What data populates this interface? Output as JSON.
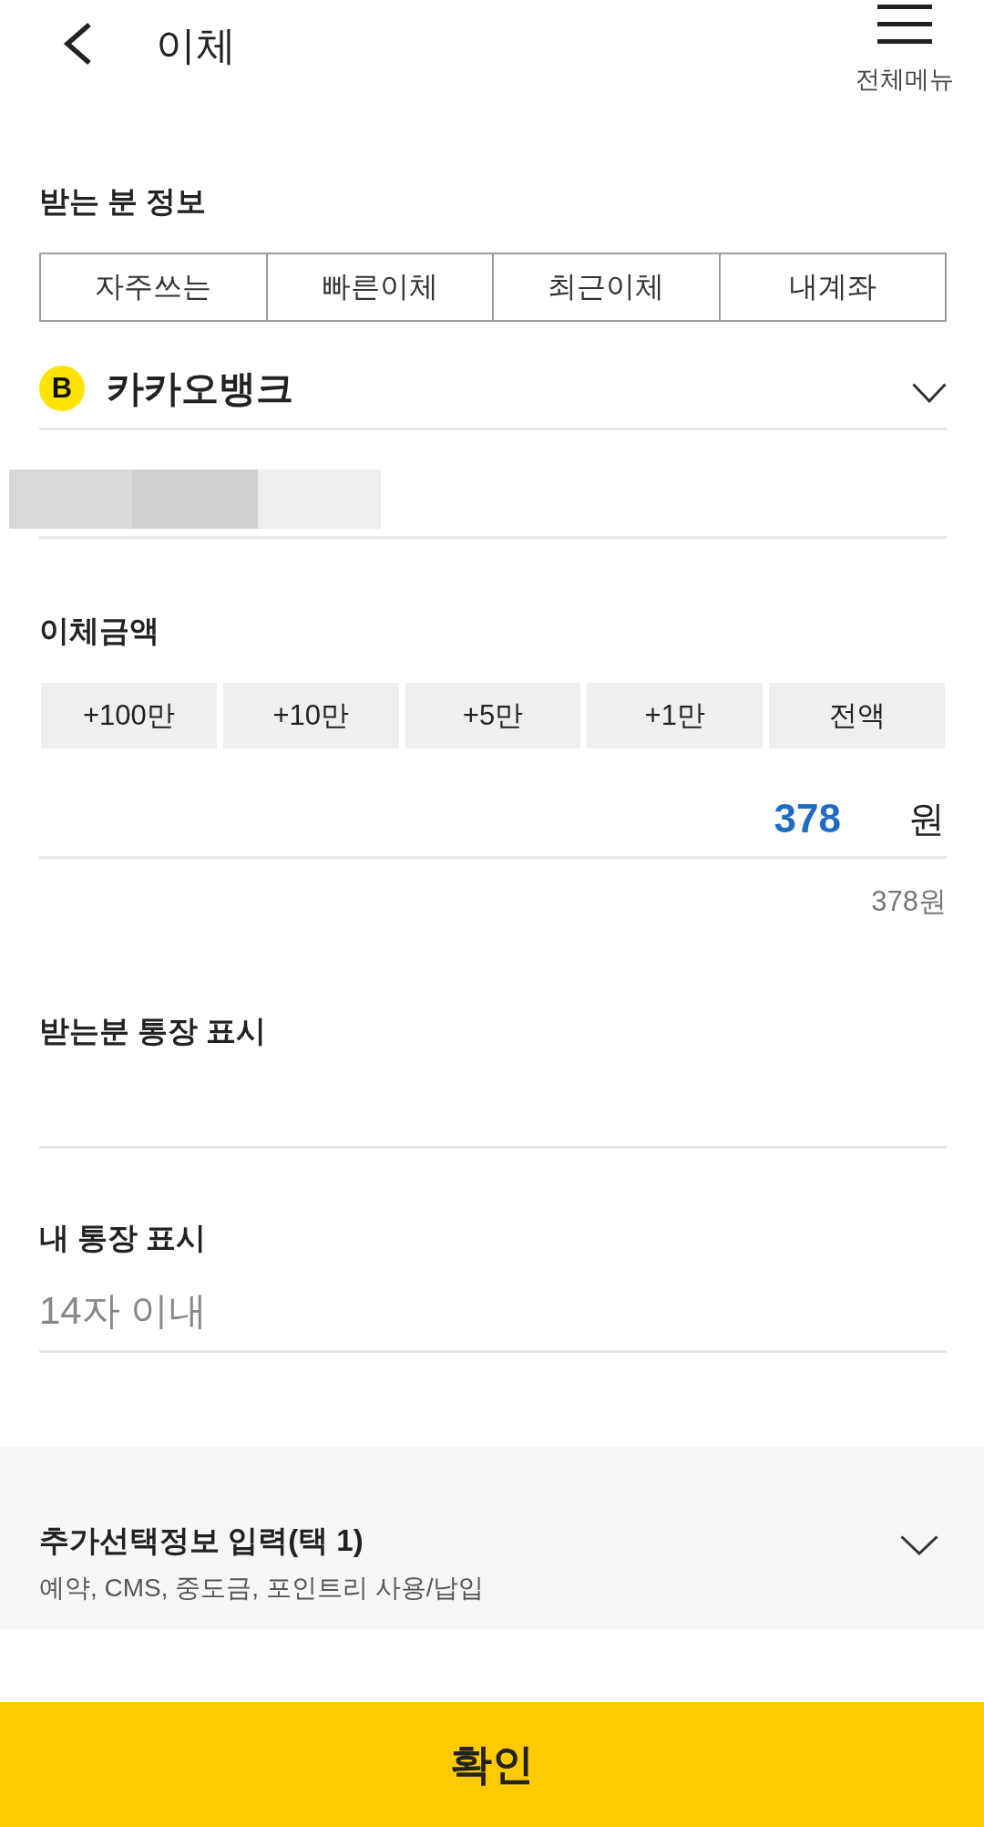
{
  "header": {
    "title": "이체",
    "menu_label": "전체메뉴"
  },
  "recipient": {
    "heading": "받는 분 정보",
    "tabs": [
      "자주쓰는",
      "빠른이체",
      "최근이체",
      "내계좌"
    ],
    "bank": {
      "logo_text": "B",
      "name": "카카오뱅크"
    }
  },
  "amount": {
    "heading": "이체금액",
    "quick_buttons": [
      "+100만",
      "+10만",
      "+5만",
      "+1만",
      "전액"
    ],
    "value": "378",
    "unit": "원",
    "readout": "378원"
  },
  "recipient_memo": {
    "label": "받는분 통장 표시"
  },
  "my_memo": {
    "label": "내 통장 표시",
    "placeholder": "14자 이내"
  },
  "extra_options": {
    "title": "추가선택정보 입력(택 1)",
    "subtitle": "예약, CMS, 중도금, 포인트리 사용/납입",
    "expanded": false
  },
  "confirm_button": {
    "label": "확인"
  }
}
